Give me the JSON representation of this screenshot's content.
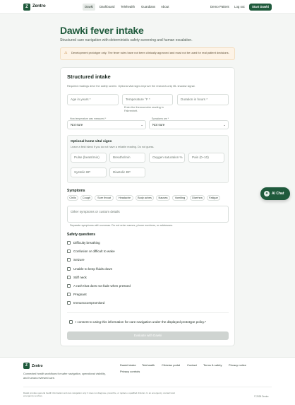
{
  "header": {
    "logo_mark": "Z",
    "brand": "Zentro",
    "nav": [
      "Dawki",
      "Dashboard",
      "Telehealth",
      "Guardians",
      "About"
    ],
    "active_nav": "Dawki",
    "demo_patient": "Demo Patient",
    "logout": "Log out",
    "cta": "Start Dawki"
  },
  "page": {
    "title": "Dawki fever intake",
    "subtitle": "Structured care navigation with deterministic safety screening and human escalation.",
    "warning": "Development prototype only. The fever rules have not been clinically approved and must not be used for real patient decisions."
  },
  "form": {
    "title": "Structured intake",
    "intro": "Required readings drive the safety screen. Optional vital signs improve the research-only ML shadow signal.",
    "age_placeholder": "Age in years *",
    "temp_placeholder": "Temperature °F *",
    "duration_placeholder": "Duration in hours *",
    "temp_hint": "Enter the thermometer reading in Fahrenheit.",
    "measured_label": "How temperature was measured *",
    "measured_value": "Not sure",
    "symptoms_are_label": "Symptoms are *",
    "symptoms_are_value": "Not sure",
    "vitals": {
      "title": "Optional home vital signs",
      "hint": "Leave a field blank if you do not have a reliable reading. Do not guess.",
      "pulse": "Pulse (beats/min)",
      "breaths": "Breaths/min",
      "oxygen": "Oxygen saturation %",
      "pain": "Pain (0–10)",
      "systolic": "Systolic BP",
      "diastolic": "Diastolic BP"
    },
    "symptoms_title": "Symptoms",
    "symptom_chips": [
      "Chills",
      "Cough",
      "Sore throat",
      "Headache",
      "Body aches",
      "Nausea",
      "Vomiting",
      "Diarrhea",
      "Fatigue"
    ],
    "other_placeholder": "Other symptoms or custom details",
    "other_hint": "Separate symptoms with commas. Do not enter names, phone numbers, or addresses.",
    "safety_title": "Safety questions",
    "safety_items": [
      "Difficulty breathing",
      "Confusion or difficult to wake",
      "Seizure",
      "Unable to keep fluids down",
      "Stiff neck",
      "A rash that does not fade when pressed",
      "Pregnant",
      "Immunocompromised"
    ],
    "consent": "I consent to using this information for care navigation under the displayed prototype policy.*",
    "submit": "Evaluate with Dawki"
  },
  "ai_chat": {
    "label": "AI Chat",
    "icon": "sparkle-icon"
  },
  "footer": {
    "logo_mark": "Z",
    "brand": "Zentro",
    "description": "Connected health workflows for safer navigation, operational visibility, and human-reviewed care.",
    "links": [
      "Dawki intake",
      "Telehealth",
      "Clinician portal",
      "Contact",
      "Terms & safety",
      "Privacy notice",
      "Privacy controls"
    ],
    "legal": "Dawki provides general health information and care navigation only. It does not diagnose, prescribe, or replace a qualified clinician. In an emergency, contact local emergency services.",
    "copyright": "© 2026 Zentro"
  },
  "colors": {
    "brand": "#1f5a3c",
    "warning_bg": "#fdf3e6",
    "page_bg": "#f4f6f4"
  }
}
